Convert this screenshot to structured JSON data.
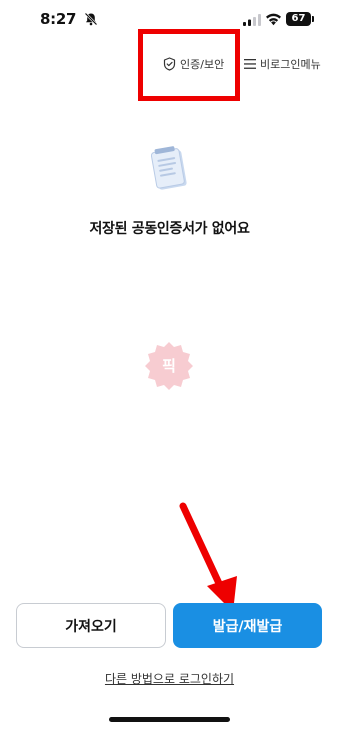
{
  "status_bar": {
    "time": "8:27",
    "battery": "67",
    "icons": [
      "mute-bell-icon",
      "signal-icon",
      "wifi-icon",
      "battery-icon"
    ]
  },
  "top_nav": {
    "security_label": "인증/보안",
    "security_icon": "shield-check-icon",
    "menu_label": "비로그인메뉴",
    "menu_icon": "hamburger-icon"
  },
  "empty_state": {
    "icon": "document-icon",
    "message": "저장된 공동인증서가 없어요"
  },
  "watermark": {
    "text": "픽"
  },
  "actions": {
    "import_label": "가져오기",
    "issue_label": "발급/재발급"
  },
  "other_login_label": "다른 방법으로 로그인하기",
  "colors": {
    "primary": "#1a8fe3",
    "annotation": "#ee0000",
    "watermark": "#f2a3ad"
  }
}
